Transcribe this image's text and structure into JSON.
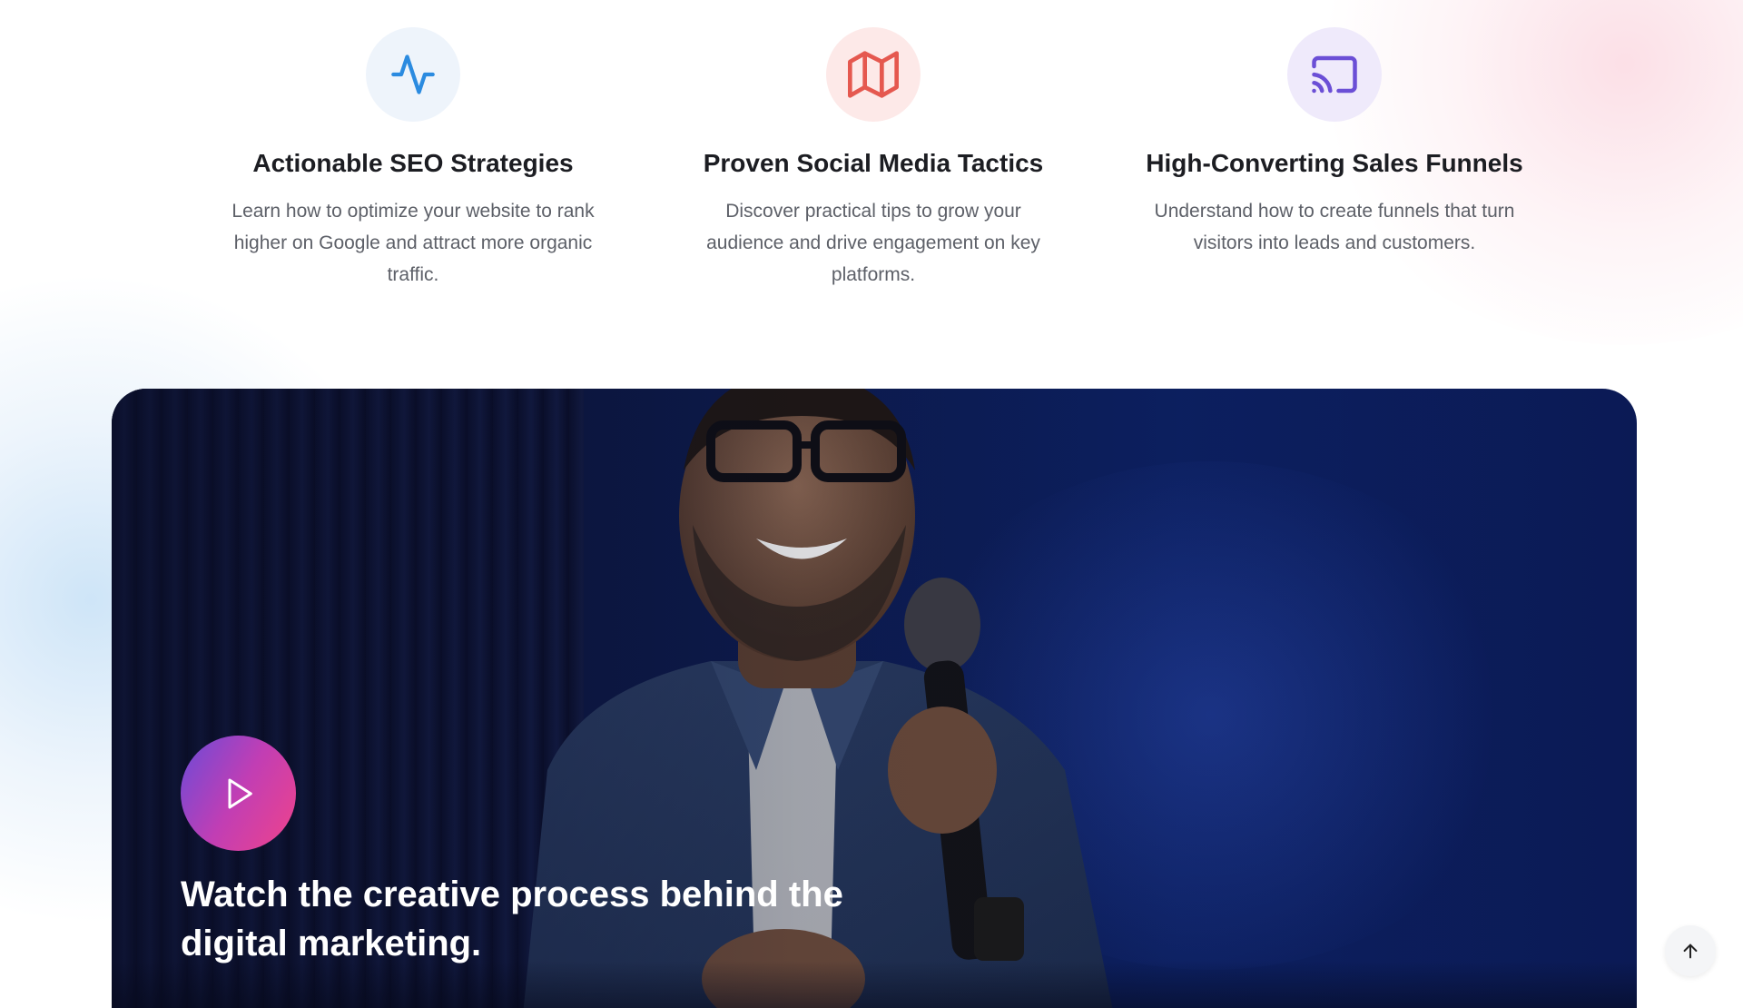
{
  "features": [
    {
      "icon": "activity-icon",
      "icon_color": "#2b8be0",
      "icon_bg": "#eef4fb",
      "title": "Actionable SEO Strategies",
      "description": "Learn how to optimize your website to rank higher on Google and attract more organic traffic."
    },
    {
      "icon": "map-icon",
      "icon_color": "#e5584f",
      "icon_bg": "#fde9e8",
      "title": "Proven Social Media Tactics",
      "description": "Discover practical tips to grow your audience and drive engagement on key platforms."
    },
    {
      "icon": "cast-icon",
      "icon_color": "#6b4fd6",
      "icon_bg": "#efeafb",
      "title": "High-Converting Sales Funnels",
      "description": "Understand how to create funnels that turn visitors into leads and customers."
    }
  ],
  "video_banner": {
    "heading": "Watch the creative process behind the digital marketing.",
    "play_icon": "play-icon",
    "image_subject": "speaker-with-microphone"
  },
  "scroll_top": {
    "icon": "arrow-up-icon"
  },
  "colors": {
    "heading_text": "#1c1d22",
    "body_text": "#5d6068",
    "play_gradient_start": "#6a4bd8",
    "play_gradient_end": "#f0438a",
    "banner_bg": "#0d1a4c"
  }
}
